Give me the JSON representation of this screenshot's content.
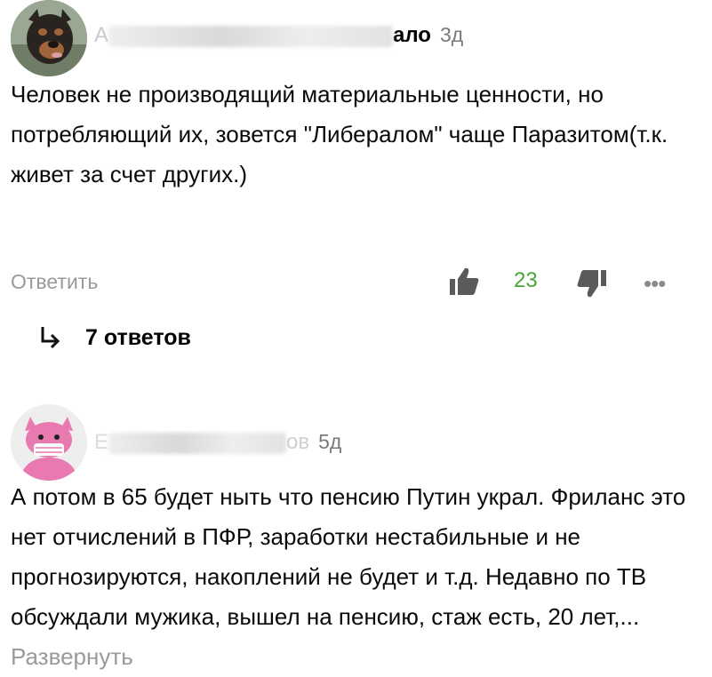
{
  "comments": [
    {
      "author_visible": "ало",
      "author_prefix": "А",
      "time": "3д",
      "text": "Человек не производящий материальные ценности, но потребляющий их, зовется \"Либералом\" чаще Паразитом(т.к. живет за счет других.)",
      "reply_label": "Ответить",
      "likes": "23",
      "replies_label": "7 ответов"
    },
    {
      "author_visible": "ов",
      "author_prefix": "Е",
      "time": "5д",
      "text": "А потом в 65 будет ныть что пенсию Путин украл. Фриланс это нет отчислений в ПФР, заработки нестабильные и не прогнозируются, накоплений не будет и т.д. Недавно по ТВ обсуждали мужика, вышел на пенсию, стаж есть, 20 лет,...",
      "expand_label": "Развернуть"
    }
  ],
  "colors": {
    "like": "#4aa43a",
    "muted": "#9a9a9a"
  },
  "icons": [
    "thumb-up-icon",
    "thumb-down-icon",
    "more-dots-icon",
    "reply-arrow-icon"
  ]
}
